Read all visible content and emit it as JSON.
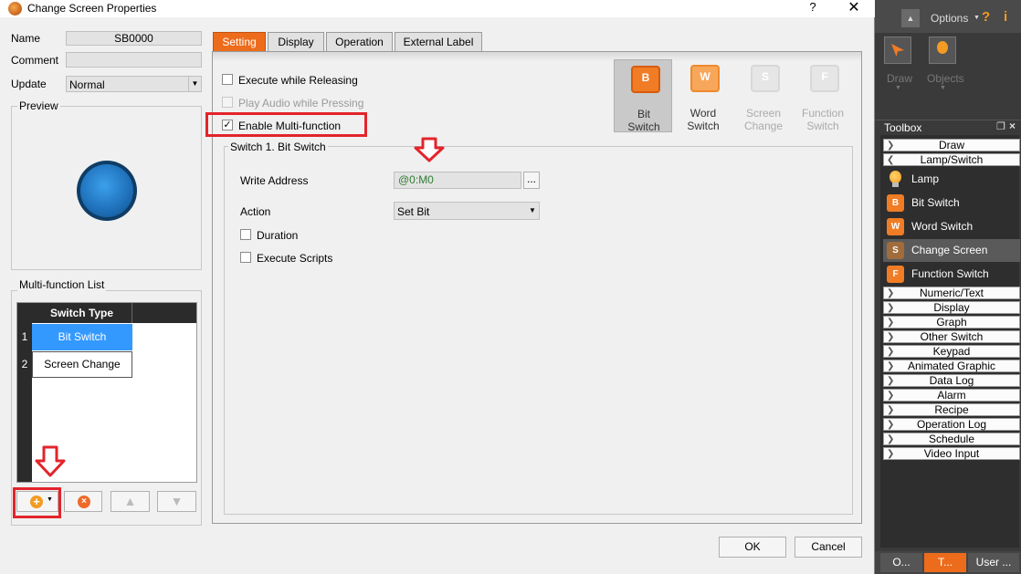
{
  "window": {
    "title": "Change Screen Properties",
    "help": "?",
    "close": "✕"
  },
  "left": {
    "name_label": "Name",
    "name_value": "SB0000",
    "comment_label": "Comment",
    "comment_value": "",
    "update_label": "Update",
    "update_value": "Normal",
    "preview_label": "Preview",
    "mf_list_label": "Multi-function List",
    "mf_header": "Switch Type",
    "mf_rows": [
      {
        "index": "1",
        "type": "Bit Switch"
      },
      {
        "index": "2",
        "type": "Screen Change"
      }
    ]
  },
  "tabs": [
    "Setting",
    "Display",
    "Operation",
    "External Label"
  ],
  "setting": {
    "execute_releasing": "Execute while Releasing",
    "play_audio": "Play Audio while Pressing",
    "enable_multi": "Enable Multi-function",
    "enable_multi_check": "✓",
    "switch_types": [
      "Bit\nSwitch",
      "Word\nSwitch",
      "Screen\nChange",
      "Function\nSwitch"
    ],
    "switch_type_letters": [
      "B",
      "W",
      "S",
      "F"
    ],
    "group_title": "Switch 1. Bit Switch",
    "write_address_label": "Write Address",
    "write_address_value": "@0:M0",
    "browse": "...",
    "action_label": "Action",
    "action_value": "Set Bit",
    "duration": "Duration",
    "execute_scripts": "Execute Scripts"
  },
  "buttons": {
    "ok": "OK",
    "cancel": "Cancel"
  },
  "right": {
    "options_label": "Options",
    "draw_label": "Draw",
    "objects_label": "Objects",
    "toolbox_title": "Toolbox",
    "sections_top": [
      "Draw",
      "Lamp/Switch"
    ],
    "items": [
      "Lamp",
      "Bit Switch",
      "Word Switch",
      "Change Screen",
      "Function Switch"
    ],
    "item_letters": [
      "",
      "B",
      "W",
      "S",
      "F"
    ],
    "sections_bottom": [
      "Numeric/Text",
      "Display",
      "Graph",
      "Other Switch",
      "Keypad",
      "Animated Graphic",
      "Data Log",
      "Alarm",
      "Recipe",
      "Operation Log",
      "Schedule",
      "Video Input"
    ],
    "bottom_tabs": [
      "O...",
      "T...",
      "User ..."
    ]
  },
  "colors": {
    "accent": "#ed6c1c",
    "highlight_red": "#e3242b",
    "selected_blue": "#3399ff",
    "preview_blue": "#1e6fb8"
  }
}
